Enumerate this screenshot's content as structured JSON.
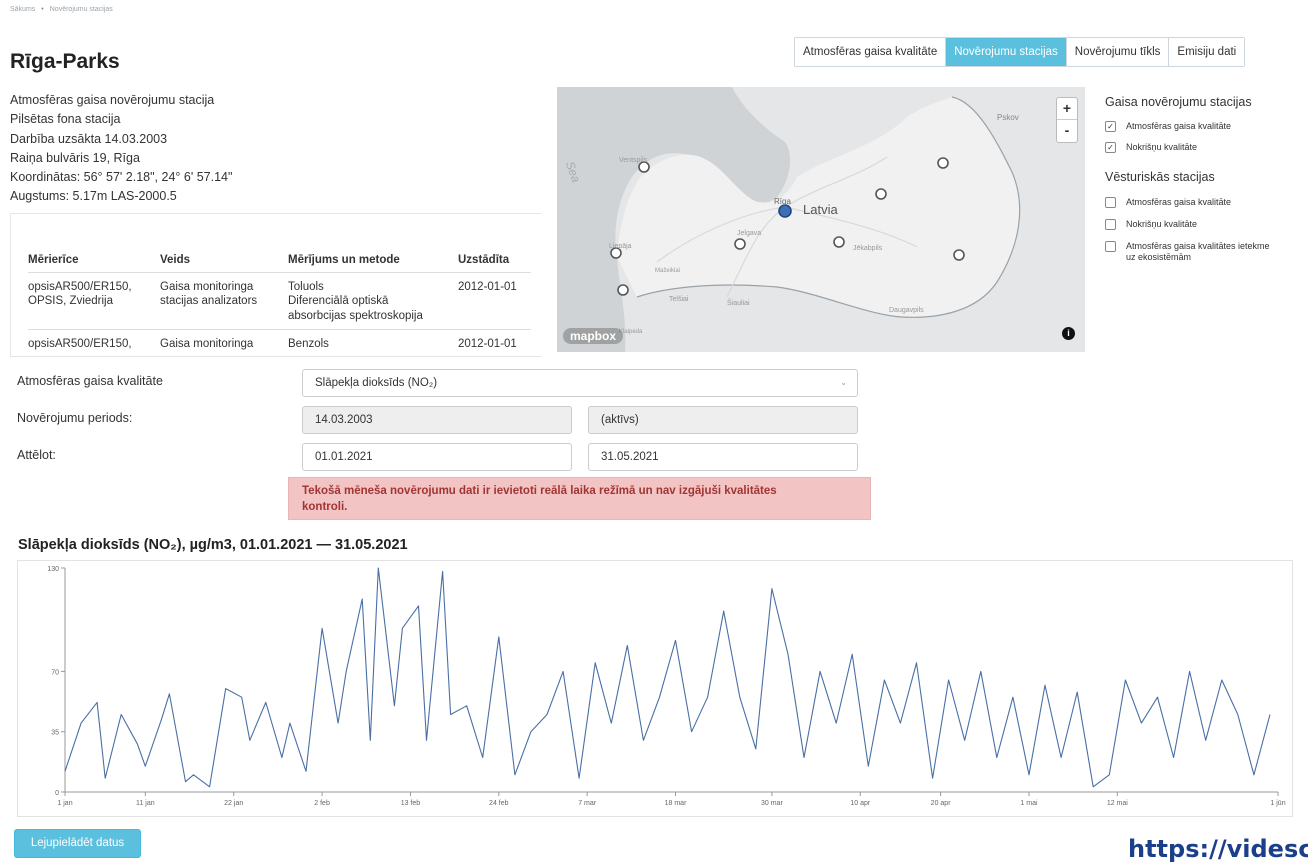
{
  "breadcrumb": {
    "home": "Sākums",
    "current": "Novērojumu stacijas"
  },
  "page": {
    "title": "Rīga-Parks"
  },
  "tabs": [
    {
      "label": "Atmosfēras gaisa kvalitāte",
      "active": false
    },
    {
      "label": "Novērojumu stacijas",
      "active": true
    },
    {
      "label": "Novērojumu tīkls",
      "active": false
    },
    {
      "label": "Emisiju dati",
      "active": false
    }
  ],
  "station": {
    "type": "Atmosfēras gaisa novērojumu stacija",
    "category": "Pilsētas fona stacija",
    "started": "Darbība uzsākta 14.03.2003",
    "address": "Raiņa bulvāris 19, Rīga",
    "coordinates": "Koordinātas: 56° 57' 2.18\", 24° 6' 57.14\"",
    "altitude": "Augstums: 5.17m LAS-2000.5"
  },
  "equipment": {
    "headers": [
      "Mērierīce",
      "Veids",
      "Mērījums un metode",
      "Uzstādīta"
    ],
    "rows": [
      {
        "device_1": "opsisAR500/ER150,",
        "device_2": "OPSIS, Zviedrija",
        "type_1": "Gaisa monitoringa",
        "type_2": "stacijas analizators",
        "method_1": "Toluols",
        "method_2": "Diferenciālā optiskā",
        "method_3": "absorbcijas spektroskopija",
        "installed": "2012-01-01"
      },
      {
        "device_1": "opsisAR500/ER150,",
        "type_1": "Gaisa monitoringa",
        "method_1": "Benzols",
        "installed": "2012-01-01"
      }
    ]
  },
  "map": {
    "labels": {
      "country": "Latvia",
      "capital": "Rīga",
      "pskov": "Pskov",
      "ventspils": "Ventspils",
      "jelgava": "Jelgava",
      "jekabpils": "Jēkabpils",
      "liepaja": "Liepāja",
      "siauliai": "Šiauliai",
      "telsiai": "Telšiai",
      "daugavpils": "Daugavpils",
      "mazeikiai": "Mažeikiai",
      "klaipeda": "Klaipėda",
      "sea": "Sea"
    },
    "zoom_in": "+",
    "zoom_out": "-",
    "attribution": "mapbox",
    "info": "i"
  },
  "legend": {
    "current_title": "Gaisa novērojumu stacijas",
    "current_items": [
      {
        "label": "Atmosfēras gaisa kvalitāte",
        "checked": true
      },
      {
        "label": "Nokrišņu kvalitāte",
        "checked": true
      }
    ],
    "historic_title": "Vēsturiskās stacijas",
    "historic_items": [
      {
        "label": "Atmosfēras gaisa kvalitāte",
        "checked": false
      },
      {
        "label": "Nokrišņu kvalitāte",
        "checked": false
      },
      {
        "label_1": "Atmosfēras gaisa kvalitātes ietekme",
        "label_2": "uz ekosistēmām",
        "checked": false
      }
    ],
    "check_mark": "✓"
  },
  "form": {
    "quality_label": "Atmosfēras gaisa kvalitāte",
    "quality_value": "Slāpekļa dioksīds (NO₂)",
    "period_label": "Novērojumu periods:",
    "period_from": "14.03.2003",
    "period_to": "(aktīvs)",
    "display_label": "Attēlot:",
    "display_from": "01.01.2021",
    "display_to": "31.05.2021",
    "caret": "⌄"
  },
  "alert": {
    "line1": "Tekošā mēneša novērojumu dati ir ievietoti reālā laika režīmā un nav izgājuši kvalitātes",
    "line2": "kontroli."
  },
  "chart_title": "Slāpekļa dioksīds (NO₂), µg/m3, 01.01.2021 — 31.05.2021",
  "chart_data": {
    "type": "line",
    "title": "Slāpekļa dioksīds (NO₂), µg/m3, 01.01.2021 — 31.05.2021",
    "x_range": [
      "2021-01-01",
      "2021-06-01"
    ],
    "x_ticks": [
      "1 jan",
      "11 jan",
      "22 jan",
      "2 feb",
      "13 feb",
      "24 feb",
      "7 mar",
      "18 mar",
      "30 mar",
      "10 apr",
      "20 apr",
      "1 mai",
      "12 mai",
      "1 jūn"
    ],
    "y_ticks": [
      0,
      35,
      70,
      130
    ],
    "ylim": [
      0,
      130
    ],
    "color": "#4a6fa5",
    "series": [
      {
        "x": [
          "2021-01-01",
          "2021-01-03",
          "2021-01-05",
          "2021-01-06",
          "2021-01-08",
          "2021-01-10",
          "2021-01-11",
          "2021-01-13",
          "2021-01-14",
          "2021-01-16",
          "2021-01-17",
          "2021-01-19",
          "2021-01-21",
          "2021-01-23",
          "2021-01-24",
          "2021-01-26",
          "2021-01-28",
          "2021-01-29",
          "2021-01-31",
          "2021-02-02",
          "2021-02-04",
          "2021-02-05",
          "2021-02-07",
          "2021-02-08",
          "2021-02-09",
          "2021-02-11",
          "2021-02-12",
          "2021-02-14",
          "2021-02-15",
          "2021-02-17",
          "2021-02-18",
          "2021-02-20",
          "2021-02-22",
          "2021-02-24",
          "2021-02-26",
          "2021-02-28",
          "2021-03-02",
          "2021-03-04",
          "2021-03-06",
          "2021-03-08",
          "2021-03-10",
          "2021-03-12",
          "2021-03-14",
          "2021-03-16",
          "2021-03-18",
          "2021-03-20",
          "2021-03-22",
          "2021-03-24",
          "2021-03-26",
          "2021-03-28",
          "2021-03-30",
          "2021-04-01",
          "2021-04-03",
          "2021-04-05",
          "2021-04-07",
          "2021-04-09",
          "2021-04-11",
          "2021-04-13",
          "2021-04-15",
          "2021-04-17",
          "2021-04-19",
          "2021-04-21",
          "2021-04-23",
          "2021-04-25",
          "2021-04-27",
          "2021-04-29",
          "2021-05-01",
          "2021-05-03",
          "2021-05-05",
          "2021-05-07",
          "2021-05-09",
          "2021-05-11",
          "2021-05-13",
          "2021-05-15",
          "2021-05-17",
          "2021-05-19",
          "2021-05-21",
          "2021-05-23",
          "2021-05-25",
          "2021-05-27",
          "2021-05-29",
          "2021-05-31"
        ],
        "y": [
          12,
          40,
          52,
          8,
          45,
          28,
          15,
          42,
          57,
          6,
          10,
          3,
          60,
          55,
          30,
          52,
          20,
          40,
          12,
          95,
          40,
          70,
          112,
          30,
          130,
          50,
          95,
          108,
          30,
          128,
          45,
          50,
          20,
          90,
          10,
          35,
          45,
          70,
          8,
          75,
          40,
          85,
          30,
          55,
          88,
          35,
          55,
          105,
          55,
          25,
          118,
          80,
          20,
          70,
          40,
          80,
          15,
          65,
          40,
          75,
          8,
          65,
          30,
          70,
          20,
          55,
          10,
          62,
          20,
          58,
          3,
          10,
          65,
          40,
          55,
          20,
          70,
          30,
          65,
          45,
          10,
          45
        ]
      }
    ]
  },
  "download_button": "Lejupielādēt datus",
  "watermark": "https://videsc"
}
